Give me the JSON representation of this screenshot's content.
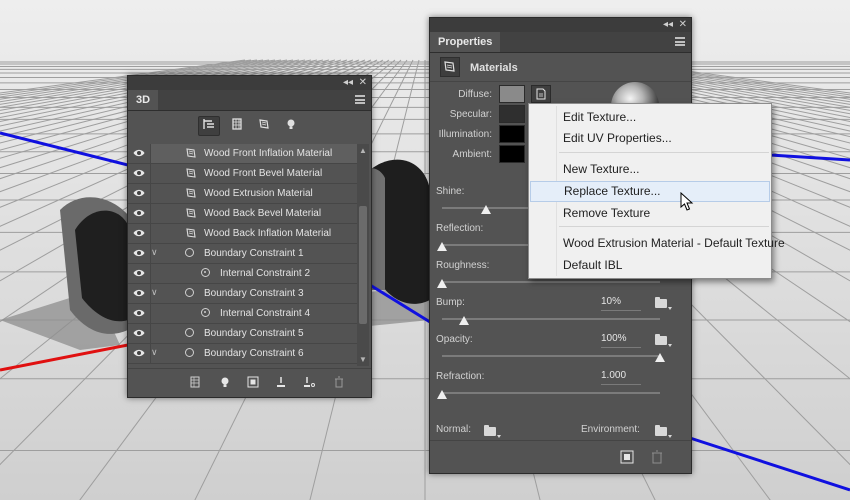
{
  "panel3d": {
    "tab": "3D",
    "collapse_glyph": "◂◂",
    "close_glyph": "✕",
    "filters": [
      {
        "icon": "whole-scene-icon",
        "active": true
      },
      {
        "icon": "meshes-icon",
        "active": false
      },
      {
        "icon": "materials-icon",
        "active": false
      },
      {
        "icon": "lights-icon",
        "active": false
      }
    ],
    "layers": [
      {
        "label": "Wood Front Inflation Material",
        "type": "material",
        "indent": 0,
        "twist": "",
        "selected": true
      },
      {
        "label": "Wood Front Bevel Material",
        "type": "material",
        "indent": 0,
        "twist": "",
        "selected": false
      },
      {
        "label": "Wood Extrusion Material",
        "type": "material",
        "indent": 0,
        "twist": "",
        "selected": false
      },
      {
        "label": "Wood Back Bevel Material",
        "type": "material",
        "indent": 0,
        "twist": "",
        "selected": false
      },
      {
        "label": "Wood Back Inflation Material",
        "type": "material",
        "indent": 0,
        "twist": "",
        "selected": false
      },
      {
        "label": "Boundary Constraint 1",
        "type": "constraint",
        "indent": 0,
        "twist": "v",
        "selected": false
      },
      {
        "label": "Internal Constraint 2",
        "type": "internal",
        "indent": 1,
        "twist": "",
        "selected": false
      },
      {
        "label": "Boundary Constraint 3",
        "type": "constraint",
        "indent": 0,
        "twist": "v",
        "selected": false
      },
      {
        "label": "Internal Constraint 4",
        "type": "internal",
        "indent": 1,
        "twist": "",
        "selected": false
      },
      {
        "label": "Boundary Constraint 5",
        "type": "constraint",
        "indent": 0,
        "twist": "",
        "selected": false
      },
      {
        "label": "Boundary Constraint 6",
        "type": "constraint",
        "indent": 0,
        "twist": "v",
        "selected": false
      }
    ],
    "footer_icons": [
      "mesh-add-icon",
      "light-add-icon",
      "render-icon",
      "ground-plane-icon",
      "constraint-icon",
      "trash-icon"
    ]
  },
  "properties": {
    "tab": "Properties",
    "collapse_glyph": "◂◂",
    "close_glyph": "✕",
    "section_title": "Materials",
    "labels": {
      "diffuse": "Diffuse:",
      "specular": "Specular:",
      "illumination": "Illumination:",
      "ambient": "Ambient:",
      "shine": "Shine:",
      "reflection": "Reflection:",
      "roughness": "Roughness:",
      "bump": "Bump:",
      "opacity": "Opacity:",
      "refraction": "Refraction:",
      "normal": "Normal:",
      "environment": "Environment:"
    },
    "swatches": {
      "diffuse": "#8a8a8a",
      "specular": "#2f2f2f",
      "illumination": "#000000",
      "ambient": "#000000"
    },
    "values": {
      "bump": "10%",
      "opacity": "100%",
      "refraction": "1.000"
    },
    "sliders": {
      "shine": 0.2,
      "reflection": 0.0,
      "roughness": 0.0,
      "bump": 0.1,
      "opacity": 1.0,
      "refraction": 0.0
    }
  },
  "context_menu": {
    "items": [
      {
        "label": "Edit Texture...",
        "hover": false
      },
      {
        "label": "Edit UV Properties...",
        "hover": false
      },
      {
        "label": "New Texture...",
        "hover": false
      },
      {
        "label": "Replace Texture...",
        "hover": true
      },
      {
        "label": "Remove Texture",
        "hover": false
      },
      {
        "label": "Wood Extrusion Material - Default Texture",
        "hover": false
      },
      {
        "label": "Default IBL",
        "hover": false
      }
    ]
  },
  "colors": {
    "panel": "#535353",
    "x_axis": "#e01010",
    "z_axis": "#1010e0",
    "menu_bg": "#f0f0f0",
    "menu_hover": "#e5eef9"
  }
}
